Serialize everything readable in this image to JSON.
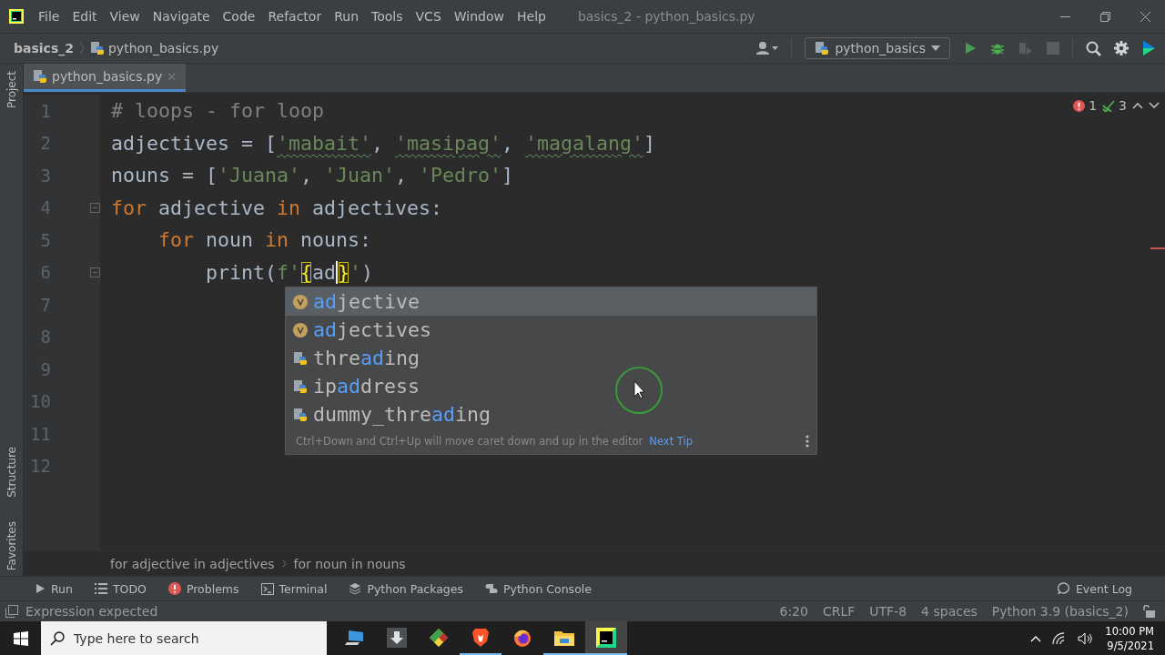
{
  "window": {
    "title": "basics_2 - python_basics.py"
  },
  "menu": [
    "File",
    "Edit",
    "View",
    "Navigate",
    "Code",
    "Refactor",
    "Run",
    "Tools",
    "VCS",
    "Window",
    "Help"
  ],
  "navbar": {
    "project": "basics_2",
    "file": "python_basics.py",
    "run_config": "python_basics"
  },
  "toolbar": [
    {
      "kind": "run",
      "disabled": false
    },
    {
      "kind": "debug",
      "disabled": false
    },
    {
      "kind": "coverage",
      "disabled": true
    },
    {
      "kind": "stop",
      "disabled": true
    }
  ],
  "side_panels": {
    "top": [
      "Project"
    ],
    "bottom": [
      "Structure",
      "Favorites"
    ]
  },
  "tabs": [
    {
      "label": "python_basics.py",
      "selected": true,
      "close": "✕"
    }
  ],
  "editor": {
    "problems": {
      "errors": "1",
      "warnings": "3"
    },
    "lines": [
      {
        "number": "1",
        "fold": false,
        "tokens": [
          {
            "kind": "comment",
            "text": "# loops - for loop"
          }
        ]
      },
      {
        "number": "2",
        "fold": false,
        "tokens": [
          {
            "kind": "plain",
            "text": "adjectives = ["
          },
          {
            "kind": "string_typo",
            "text": "'mabait'"
          },
          {
            "kind": "plain",
            "text": ", "
          },
          {
            "kind": "string_typo",
            "text": "'masipag'"
          },
          {
            "kind": "plain",
            "text": ", "
          },
          {
            "kind": "string_typo",
            "text": "'magalang'"
          },
          {
            "kind": "plain",
            "text": "]"
          }
        ]
      },
      {
        "number": "3",
        "fold": false,
        "tokens": [
          {
            "kind": "plain",
            "text": "nouns = ["
          },
          {
            "kind": "string",
            "text": "'Juana'"
          },
          {
            "kind": "plain",
            "text": ", "
          },
          {
            "kind": "string",
            "text": "'Juan'"
          },
          {
            "kind": "plain",
            "text": ", "
          },
          {
            "kind": "string",
            "text": "'Pedro'"
          },
          {
            "kind": "plain",
            "text": "]"
          }
        ]
      },
      {
        "number": "4",
        "fold": true,
        "tokens": [
          {
            "kind": "keyword",
            "text": "for"
          },
          {
            "kind": "plain",
            "text": " adjective "
          },
          {
            "kind": "keyword",
            "text": "in"
          },
          {
            "kind": "plain",
            "text": " adjectives:"
          }
        ]
      },
      {
        "number": "5",
        "fold": false,
        "tokens": [
          {
            "kind": "keyword",
            "text": "    for"
          },
          {
            "kind": "plain",
            "text": " noun "
          },
          {
            "kind": "keyword",
            "text": "in"
          },
          {
            "kind": "plain",
            "text": " nouns:"
          }
        ]
      },
      {
        "number": "6",
        "fold": true,
        "tokens": [
          {
            "kind": "plain",
            "text": "        print("
          },
          {
            "kind": "string",
            "text": "f'"
          },
          {
            "kind": "brace",
            "text": "{"
          },
          {
            "kind": "typed",
            "text": "ad"
          },
          {
            "kind": "brace",
            "text": "}"
          },
          {
            "kind": "string",
            "text": "'"
          },
          {
            "kind": "plain",
            "text": ")"
          }
        ]
      },
      {
        "number": "7",
        "fold": false
      },
      {
        "number": "8",
        "fold": false
      },
      {
        "number": "9",
        "fold": false
      },
      {
        "number": "10",
        "fold": false
      },
      {
        "number": "11",
        "fold": false
      },
      {
        "number": "12",
        "fold": false
      }
    ]
  },
  "completion": {
    "items": [
      {
        "kind": "variable",
        "match": "ad",
        "after": "jective",
        "selected": true
      },
      {
        "kind": "variable",
        "match": "ad",
        "after": "jectives",
        "selected": false
      },
      {
        "kind": "module",
        "before": "thre",
        "match": "ad",
        "after": "ing",
        "selected": false
      },
      {
        "kind": "module",
        "before": "ip",
        "match": "ad",
        "after": "dress",
        "selected": false
      },
      {
        "kind": "module",
        "before": "dummy_thre",
        "match": "ad",
        "after": "ing",
        "selected": false
      }
    ],
    "hint": "Ctrl+Down and Ctrl+Up will move caret down and up in the editor",
    "link": "Next Tip"
  },
  "breadcrumbs": [
    "for adjective in adjectives",
    "for noun in nouns"
  ],
  "tool_windows": [
    {
      "kind": "run",
      "label": "Run"
    },
    {
      "kind": "todo",
      "label": "TODO"
    },
    {
      "kind": "problems",
      "label": "Problems"
    },
    {
      "kind": "terminal",
      "label": "Terminal"
    },
    {
      "kind": "packages",
      "label": "Python Packages"
    },
    {
      "kind": "console",
      "label": "Python Console"
    }
  ],
  "event_log": "Event Log",
  "status": {
    "message": "Expression expected",
    "items": [
      "6:20",
      "CRLF",
      "UTF-8",
      "4 spaces",
      "Python 3.9 (basics_2)"
    ]
  },
  "taskbar": {
    "search_placeholder": "Type here to search",
    "apps": [
      {
        "kind": "remote",
        "running": false,
        "selected": false
      },
      {
        "kind": "download",
        "running": false,
        "selected": false
      },
      {
        "kind": "git",
        "running": false,
        "selected": false
      },
      {
        "kind": "brave",
        "running": true,
        "selected": false
      },
      {
        "kind": "firefox",
        "running": false,
        "selected": false
      },
      {
        "kind": "folder",
        "running": true,
        "selected": false
      },
      {
        "kind": "pycharm",
        "running": true,
        "selected": true
      }
    ],
    "time": "10:00 PM",
    "date": "9/5/2021"
  }
}
